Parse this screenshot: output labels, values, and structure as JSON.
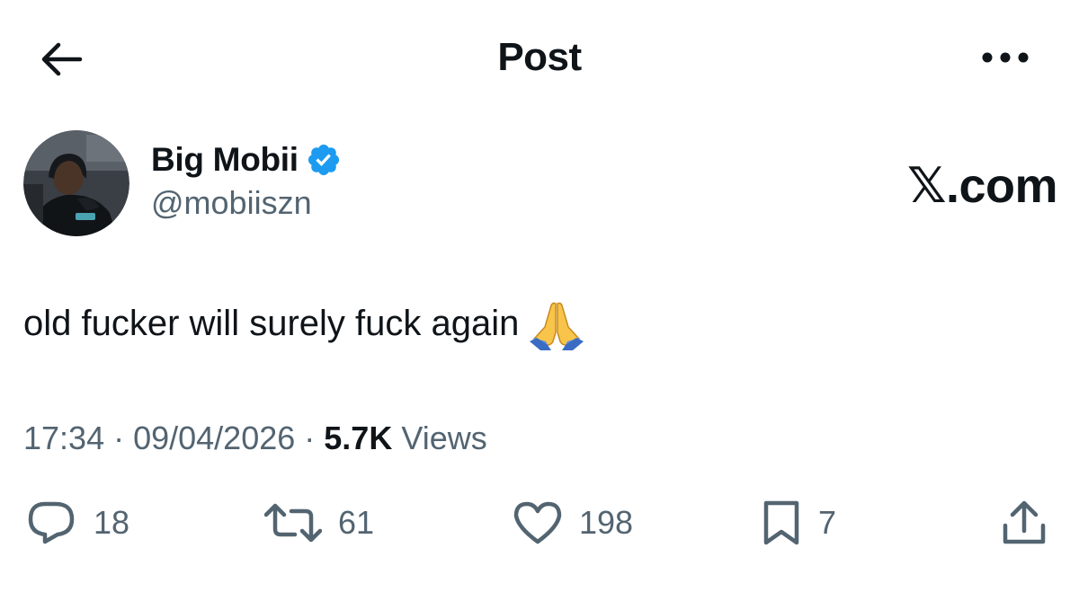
{
  "header": {
    "title": "Post",
    "back_icon": "arrow-left-icon",
    "more_icon": "more-horizontal-icon"
  },
  "author": {
    "display_name": "Big Mobii",
    "handle": "@mobiiszn",
    "verified": true,
    "verified_color": "#1d9bf0"
  },
  "watermark": "𝕏.com",
  "post": {
    "text": "old fucker will surely fuck again",
    "emoji": "folded-hands-emoji"
  },
  "meta": {
    "time": "17:34",
    "separator1": " · ",
    "date": "09/04/2026",
    "separator2": " · ",
    "views_count": "5.7K",
    "views_label": " Views"
  },
  "actions": {
    "replies": "18",
    "reposts": "61",
    "likes": "198",
    "bookmarks": "7"
  },
  "colors": {
    "text_primary": "#0f1419",
    "text_secondary": "#536471",
    "verified": "#1d9bf0"
  }
}
